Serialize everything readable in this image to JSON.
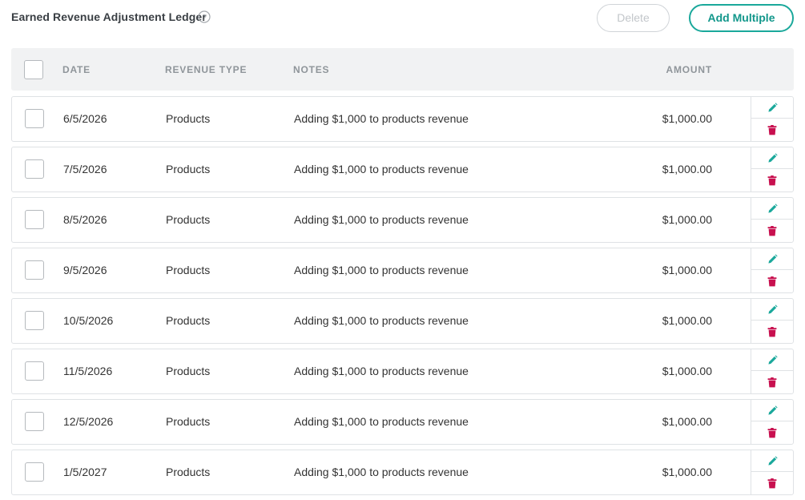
{
  "header": {
    "title": "Earned Revenue Adjustment Ledger",
    "delete_label": "Delete",
    "add_multiple_label": "Add Multiple"
  },
  "table": {
    "columns": [
      "DATE",
      "REVENUE TYPE",
      "NOTES",
      "AMOUNT"
    ],
    "rows": [
      {
        "date": "6/5/2026",
        "type": "Products",
        "notes": "Adding $1,000 to products revenue",
        "amount": "$1,000.00"
      },
      {
        "date": "7/5/2026",
        "type": "Products",
        "notes": "Adding $1,000 to products revenue",
        "amount": "$1,000.00"
      },
      {
        "date": "8/5/2026",
        "type": "Products",
        "notes": "Adding $1,000 to products revenue",
        "amount": "$1,000.00"
      },
      {
        "date": "9/5/2026",
        "type": "Products",
        "notes": "Adding $1,000 to products revenue",
        "amount": "$1,000.00"
      },
      {
        "date": "10/5/2026",
        "type": "Products",
        "notes": "Adding $1,000 to products revenue",
        "amount": "$1,000.00"
      },
      {
        "date": "11/5/2026",
        "type": "Products",
        "notes": "Adding $1,000 to products revenue",
        "amount": "$1,000.00"
      },
      {
        "date": "12/5/2026",
        "type": "Products",
        "notes": "Adding $1,000 to products revenue",
        "amount": "$1,000.00"
      },
      {
        "date": "1/5/2027",
        "type": "Products",
        "notes": "Adding $1,000 to products revenue",
        "amount": "$1,000.00"
      }
    ]
  },
  "icons": {
    "help": "question-circle-icon",
    "edit": "pencil-icon",
    "delete": "trash-icon"
  },
  "colors": {
    "accent": "#1aa89b",
    "danger": "#c8104f",
    "disabled": "#c2c6ca"
  }
}
